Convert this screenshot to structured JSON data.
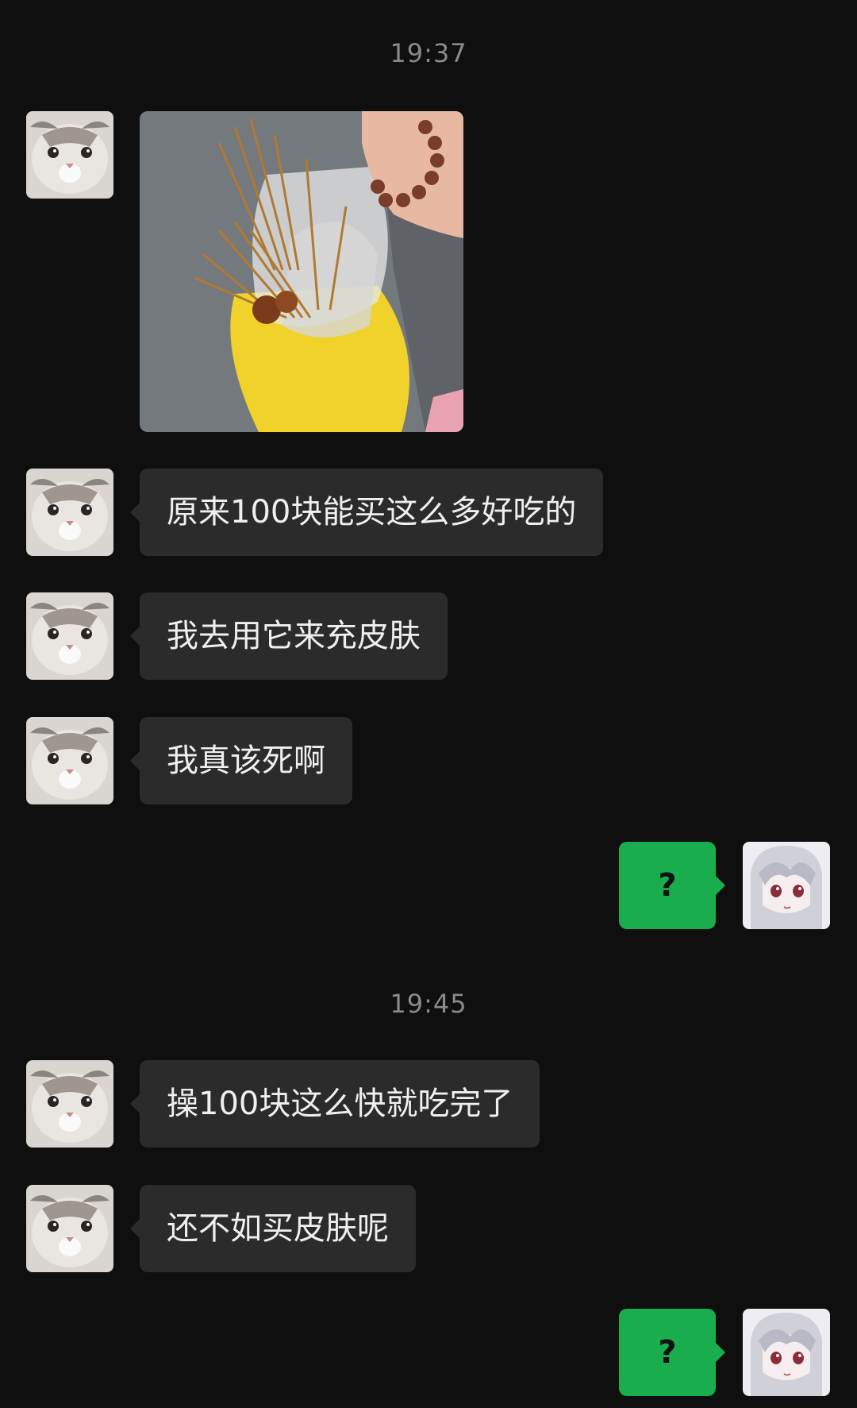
{
  "timestamps": [
    "19:37",
    "19:45"
  ],
  "messages": [
    {
      "from": "other",
      "type": "image",
      "content": "food-bag-photo"
    },
    {
      "from": "other",
      "type": "text",
      "text": "原来100块能买这么多好吃的"
    },
    {
      "from": "other",
      "type": "text",
      "text": "我去用它来充皮肤"
    },
    {
      "from": "other",
      "type": "text",
      "text": "我真该死啊"
    },
    {
      "from": "me",
      "type": "text",
      "text": "?"
    },
    {
      "from": "other",
      "type": "text",
      "text": "操100块这么快就吃完了"
    },
    {
      "from": "other",
      "type": "text",
      "text": "还不如买皮肤呢"
    },
    {
      "from": "me",
      "type": "text",
      "text": "?"
    }
  ],
  "colors": {
    "background": "#0f0f0f",
    "incoming_bubble": "#2b2b2b",
    "outgoing_bubble": "#1aad4e",
    "timestamp_text": "#8a8a8a"
  },
  "icons": {
    "other_avatar": "cat-avatar",
    "my_avatar": "anime-girl-avatar"
  }
}
